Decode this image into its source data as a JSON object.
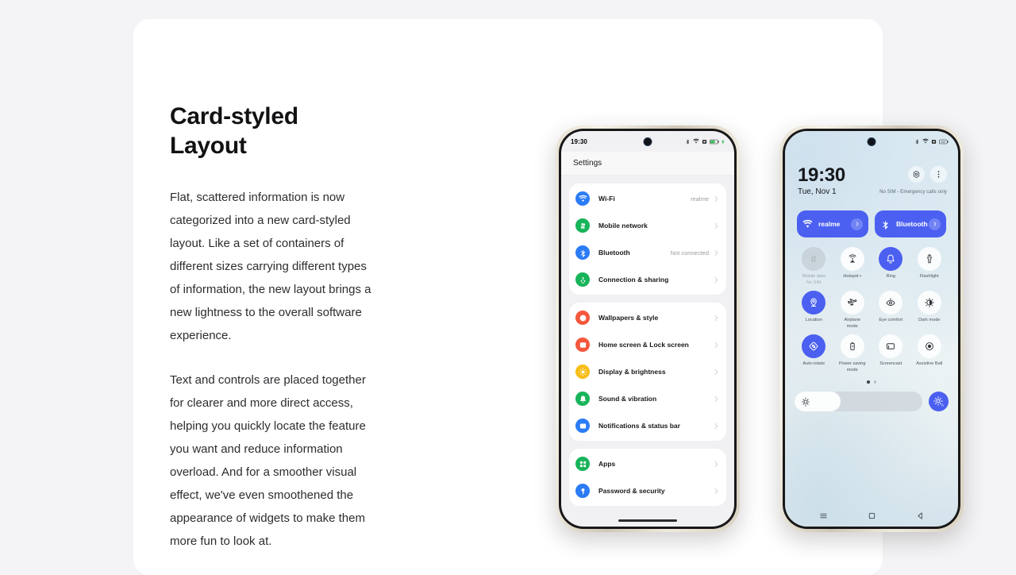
{
  "page": {
    "background_color": "#f4f4f6",
    "card_color": "#ffffff"
  },
  "copy": {
    "headline": "Card-styled\nLayout",
    "paragraph_1": "Flat, scattered information is now categorized into a new card-styled layout. Like a set of containers of different sizes carrying different types of information, the new layout brings a new lightness to the overall software experience.",
    "paragraph_2": "Text and controls are placed together for clearer and more direct access, helping you quickly locate the feature you want and reduce information overload. And for a smoother visual effect, we've even smoothened the appearance of widgets to make them more fun to look at."
  },
  "left_phone": {
    "status_bar": {
      "time": "19:30",
      "icons": [
        "bluetooth-icon",
        "wifi-icon",
        "sim-icon",
        "battery-icon",
        "charging-icon"
      ]
    },
    "header_title": "Settings",
    "groups": [
      {
        "rows": [
          {
            "icon": "wifi-icon",
            "icon_color": "#2b7cf6",
            "label": "Wi-Fi",
            "value": "realme"
          },
          {
            "icon": "mobile-network-icon",
            "icon_color": "#18b45a",
            "label": "Mobile network",
            "value": ""
          },
          {
            "icon": "bluetooth-icon",
            "icon_color": "#2b7cf6",
            "label": "Bluetooth",
            "value": "Not connected"
          },
          {
            "icon": "connection-sharing-icon",
            "icon_color": "#18b45a",
            "label": "Connection & sharing",
            "value": ""
          }
        ]
      },
      {
        "rows": [
          {
            "icon": "wallpaper-icon",
            "icon_color": "#f4573c",
            "label": "Wallpapers & style",
            "value": ""
          },
          {
            "icon": "home-lock-icon",
            "icon_color": "#f4573c",
            "label": "Home screen & Lock screen",
            "value": ""
          },
          {
            "icon": "brightness-icon",
            "icon_color": "#f8bd16",
            "label": "Display & brightness",
            "value": ""
          },
          {
            "icon": "bell-icon",
            "icon_color": "#18b45a",
            "label": "Sound & vibration",
            "value": ""
          },
          {
            "icon": "notification-icon",
            "icon_color": "#2b7cf6",
            "label": "Notifications & status bar",
            "value": ""
          }
        ]
      },
      {
        "rows": [
          {
            "icon": "apps-grid-icon",
            "icon_color": "#18b45a",
            "label": "Apps",
            "value": ""
          },
          {
            "icon": "key-icon",
            "icon_color": "#2b7cf6",
            "label": "Password & security",
            "value": ""
          }
        ]
      }
    ]
  },
  "right_phone": {
    "status_bar": {
      "icons": [
        "bluetooth-icon",
        "wifi-icon",
        "sim-icon",
        "battery-icon"
      ]
    },
    "clock": {
      "time": "19:30",
      "date": "Tue, Nov 1",
      "sim_status": "No SIM - Emergency calls only"
    },
    "header_actions": [
      {
        "name": "settings-gear-icon"
      },
      {
        "name": "overflow-menu-icon"
      }
    ],
    "pills": [
      {
        "icon": "wifi-icon",
        "label": "realme",
        "color": "#4b60f0",
        "active": true
      },
      {
        "icon": "bluetooth-icon",
        "label": "Bluetooth",
        "color": "#4b60f0",
        "active": true
      }
    ],
    "tiles": [
      {
        "icon": "mobile-data-icon",
        "label": "Mobile data",
        "sublabel": "No SIM",
        "state": "disabled"
      },
      {
        "icon": "hotspot-icon",
        "label": "Hotspot ▪",
        "sublabel": "",
        "state": "off"
      },
      {
        "icon": "ring-bell-icon",
        "label": "Ring",
        "sublabel": "",
        "state": "on"
      },
      {
        "icon": "flashlight-icon",
        "label": "Flashlight",
        "sublabel": "",
        "state": "off"
      },
      {
        "icon": "location-icon",
        "label": "Location",
        "sublabel": "",
        "state": "on"
      },
      {
        "icon": "airplane-icon",
        "label": "Airplane\nmode",
        "sublabel": "",
        "state": "off"
      },
      {
        "icon": "eye-comfort-icon",
        "label": "Eye comfort",
        "sublabel": "",
        "state": "off"
      },
      {
        "icon": "dark-mode-icon",
        "label": "Dark mode",
        "sublabel": "",
        "state": "off"
      },
      {
        "icon": "auto-rotate-icon",
        "label": "Auto-rotate",
        "sublabel": "",
        "state": "on"
      },
      {
        "icon": "power-saving-icon",
        "label": "Power saving\nmode",
        "sublabel": "",
        "state": "off"
      },
      {
        "icon": "screencast-icon",
        "label": "Screencast",
        "sublabel": "",
        "state": "off"
      },
      {
        "icon": "assistive-ball-icon",
        "label": "Assistive Ball",
        "sublabel": "",
        "state": "off"
      }
    ],
    "page_dots": {
      "count": 2,
      "active_index": 0
    },
    "brightness": {
      "icon": "brightness-icon",
      "fill_percent": 36,
      "auto_icon": "auto-brightness-icon"
    },
    "nav_bar": [
      {
        "name": "recents-nav-icon"
      },
      {
        "name": "home-nav-icon"
      },
      {
        "name": "back-nav-icon"
      }
    ]
  }
}
